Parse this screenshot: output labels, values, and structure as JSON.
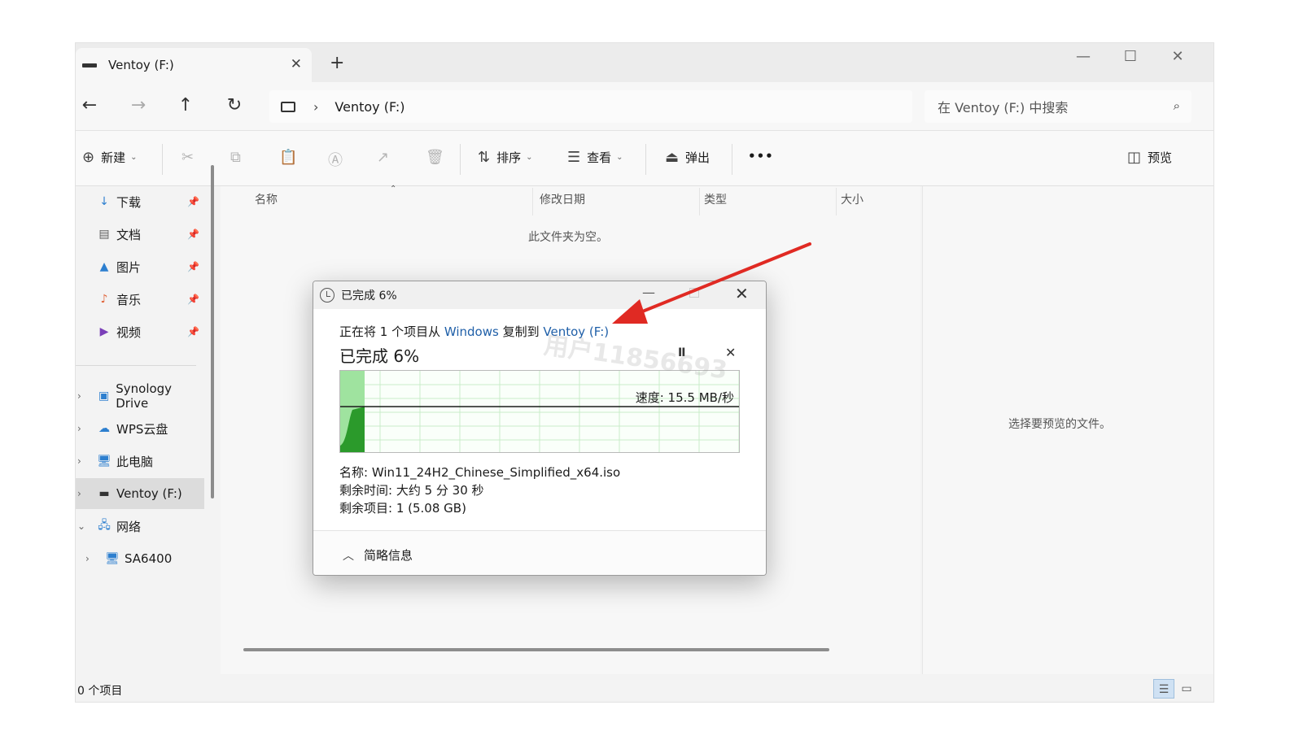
{
  "tab": {
    "title": "Ventoy (F:)",
    "close": "✕",
    "new": "+"
  },
  "window_controls": {
    "minimize": "—",
    "maximize": "☐",
    "close": "✕"
  },
  "nav": {
    "back": "←",
    "forward": "→",
    "up": "↑",
    "refresh": "↻"
  },
  "address": {
    "separator": "›",
    "path": "Ventoy (F:)"
  },
  "search": {
    "placeholder": "在 Ventoy (F:) 中搜索",
    "icon": "⌕"
  },
  "toolbar": {
    "new_label": "新建",
    "sort_label": "排序",
    "view_label": "查看",
    "eject_label": "弹出",
    "more_label": "•••",
    "preview_label": "预览"
  },
  "sidebar": {
    "quick": [
      {
        "label": "下载",
        "icon": "↓",
        "color": "#2d7fcf"
      },
      {
        "label": "文档",
        "icon": "▤",
        "color": "#5a5a5a"
      },
      {
        "label": "图片",
        "icon": "▲",
        "color": "#2d7fcf"
      },
      {
        "label": "音乐",
        "icon": "♪",
        "color": "#e0643a"
      },
      {
        "label": "视频",
        "icon": "▶",
        "color": "#7a3fb8"
      }
    ],
    "tree": [
      {
        "label": "Synology Drive",
        "expander": "›"
      },
      {
        "label": "WPS云盘",
        "expander": "›"
      },
      {
        "label": "此电脑",
        "expander": "›"
      },
      {
        "label": "Ventoy (F:)",
        "expander": "›"
      },
      {
        "label": "网络",
        "expander": "⌄"
      },
      {
        "label": "SA6400",
        "expander": "›"
      }
    ]
  },
  "columns": [
    "名称",
    "修改日期",
    "类型",
    "大小"
  ],
  "empty_message": "此文件夹为空。",
  "preview_message": "选择要预览的文件。",
  "status": {
    "count": "0 个项目"
  },
  "dialog": {
    "title": "已完成 6%",
    "desc_prefix": "正在将 1 个项目从 ",
    "source": "Windows",
    "desc_mid": " 复制到 ",
    "target": "Ventoy (F:)",
    "percent_label": "已完成 6%",
    "progress": 0.06,
    "speed": "速度: 15.5 MB/秒",
    "name_line": "名称: Win11_24H2_Chinese_Simplified_x64.iso",
    "time_line": "剩余时间: 大约 5 分 30 秒",
    "items_line": "剩余项目: 1 (5.08 GB)",
    "fewer_details": "简略信息",
    "pause": "II",
    "cancel": "✕",
    "close": "✕",
    "minimize": "—"
  },
  "watermark": "用户11856693",
  "accent_color": "#2b9a2b"
}
